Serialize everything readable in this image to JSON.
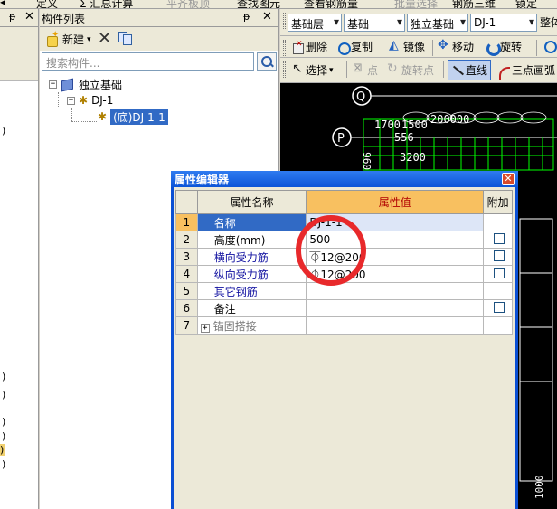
{
  "topbar": {
    "items": [
      "定义",
      "Σ 汇总计算",
      "平齐板顶",
      "查找图元",
      "查看钢筋量",
      "批量选择",
      "钢筋三维",
      "锁定"
    ]
  },
  "left_panel": {
    "pin_glyph": "ᵽ",
    "close_glyph": "✕",
    "marks": [
      ")",
      ")",
      ")",
      ")",
      ")",
      ")",
      ")"
    ]
  },
  "component_list": {
    "title": "构件列表",
    "pin_glyph": "ᵽ",
    "close_glyph": "✕",
    "new_label": "新建",
    "search_placeholder": "搜索构件...",
    "tree": {
      "root": "独立基础",
      "child": "DJ-1",
      "leaf": "(底)DJ-1-1"
    }
  },
  "toolbar": {
    "floor_combo": "基础层",
    "category_combo": "基础",
    "type_combo": "独立基础",
    "component_combo": "DJ-1",
    "overall": "整体",
    "delete": "删除",
    "copy": "复制",
    "mirror": "镜像",
    "move": "移动",
    "rotate": "旋转",
    "select": "选择",
    "point": "点",
    "rotate_point": "旋转点",
    "line": "直线",
    "arc": "三点画弧"
  },
  "canvas": {
    "labels": [
      "Q",
      "P",
      "1700",
      "1500",
      "200000",
      "556",
      "3200",
      "096",
      "1000"
    ]
  },
  "property_editor": {
    "title": "属性编辑器",
    "close_glyph": "✕",
    "headers": {
      "name": "属性名称",
      "value": "属性值",
      "extra": "附加"
    },
    "rows": [
      {
        "num": "1",
        "name": "名称",
        "value": "DJ-1-1",
        "checkbox": false
      },
      {
        "num": "2",
        "name": "高度(mm)",
        "value": "500",
        "checkbox": true
      },
      {
        "num": "3",
        "name": "横向受力筋",
        "value": "⏁12@200",
        "checkbox": true
      },
      {
        "num": "4",
        "name": "纵向受力筋",
        "value": "⏁12@200",
        "checkbox": true
      },
      {
        "num": "5",
        "name": "其它钢筋",
        "value": "",
        "checkbox": false
      },
      {
        "num": "6",
        "name": "备注",
        "value": "",
        "checkbox": true
      },
      {
        "num": "7",
        "name": "锚固搭接",
        "value": "",
        "checkbox": false,
        "expand": "+"
      }
    ]
  },
  "colors": {
    "selection": "#316ac5",
    "header_orange": "#f8c060",
    "cad_green": "#00ff00",
    "annotation_red": "#e8292b"
  }
}
